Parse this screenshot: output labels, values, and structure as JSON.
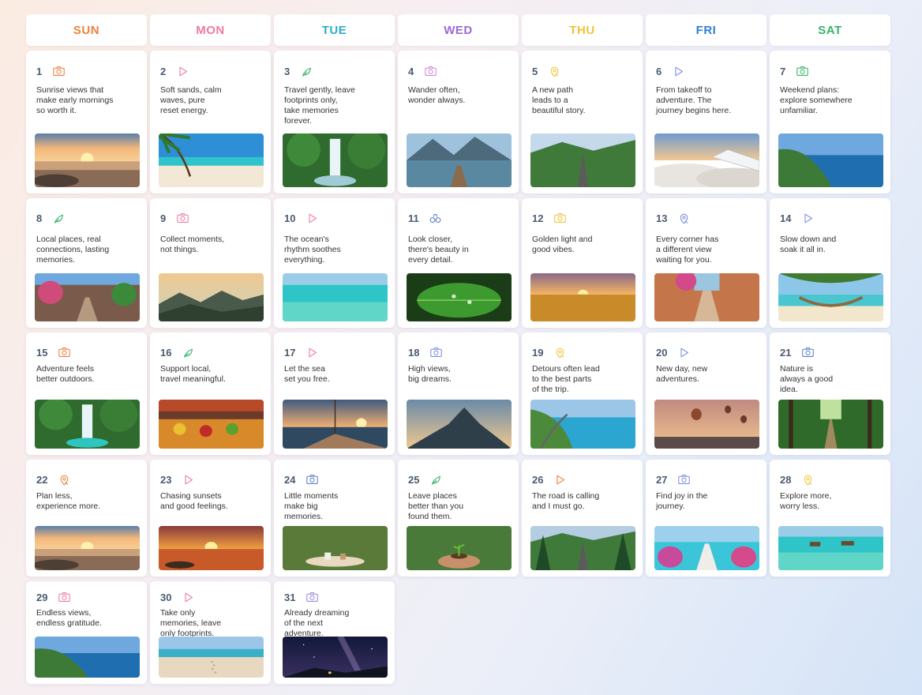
{
  "days": [
    {
      "label": "SUN",
      "color": "#f0803c"
    },
    {
      "label": "MON",
      "color": "#ef7aa0"
    },
    {
      "label": "TUE",
      "color": "#29aecb"
    },
    {
      "label": "WED",
      "color": "#9b6ad6"
    },
    {
      "label": "THU",
      "color": "#f1c43a"
    },
    {
      "label": "FRI",
      "color": "#2f7fd6"
    },
    {
      "label": "SAT",
      "color": "#36b36a"
    }
  ],
  "entries": [
    {
      "day": "1",
      "text": "Sunrise views that\nmake early mornings\nso worth it.",
      "icon": "camera-icon",
      "icon_color": "#f0803c",
      "scene": "sunset-beach"
    },
    {
      "day": "2",
      "text": "Soft sands, calm\nwaves, pure\nreset energy.",
      "icon": "play-icon",
      "icon_color": "#ef7aa0",
      "scene": "palm-beach"
    },
    {
      "day": "3",
      "text": "Travel gently, leave\nfootprints only,\ntake memories\nforever.",
      "icon": "leaf-icon",
      "icon_color": "#36b36a",
      "scene": "waterfall"
    },
    {
      "day": "4",
      "text": "Wander often,\nwonder always.",
      "icon": "camera-icon",
      "icon_color": "#d18ad6",
      "scene": "mountain-lake"
    },
    {
      "day": "5",
      "text": "A new path\nleads to a\nbeautiful story.",
      "icon": "map-icon",
      "icon_color": "#f1c43a",
      "scene": "green-road"
    },
    {
      "day": "6",
      "text": "From takeoff to\nadventure. The\njourney begins here.",
      "icon": "play-icon",
      "icon_color": "#7d8ee0",
      "scene": "plane-wing"
    },
    {
      "day": "7",
      "text": "Weekend plans:\nexplore somewhere\nunfamiliar.",
      "icon": "camera-icon",
      "icon_color": "#36b36a",
      "scene": "coast-cliff"
    },
    {
      "day": "8",
      "text": "Local places, real\nconnections, lasting\nmemories.",
      "icon": "leaf-icon",
      "icon_color": "#36b36a",
      "scene": "flower-street"
    },
    {
      "day": "9",
      "text": "Collect moments,\nnot things.",
      "icon": "camera-icon",
      "icon_color": "#ef7aa0",
      "scene": "misty-mountains"
    },
    {
      "day": "10",
      "text": "The ocean's\nrhythm soothes\neverything.",
      "icon": "play-icon",
      "icon_color": "#ef7aa0",
      "scene": "turquoise-sea"
    },
    {
      "day": "11",
      "text": "Look closer,\nthere's beauty in\nevery detail.",
      "icon": "binoculars-icon",
      "icon_color": "#5a80c8",
      "scene": "leaf-drops"
    },
    {
      "day": "12",
      "text": "Golden light and\ngood vibes.",
      "icon": "camera-icon",
      "icon_color": "#f1c43a",
      "scene": "golden-field"
    },
    {
      "day": "13",
      "text": "Every corner has\na different view\nwaiting for you.",
      "icon": "map-icon",
      "icon_color": "#7d8ee0",
      "scene": "alley"
    },
    {
      "day": "14",
      "text": "Slow down and\nsoak it all in.",
      "icon": "play-icon",
      "icon_color": "#7d8ee0",
      "scene": "hammock"
    },
    {
      "day": "15",
      "text": "Adventure feels\nbetter outdoors.",
      "icon": "camera-icon",
      "icon_color": "#f0803c",
      "scene": "jungle-waterfall"
    },
    {
      "day": "16",
      "text": "Support local,\ntravel meaningful.",
      "icon": "leaf-icon",
      "icon_color": "#36b36a",
      "scene": "market"
    },
    {
      "day": "17",
      "text": "Let the sea\nset you free.",
      "icon": "play-icon",
      "icon_color": "#ef7aa0",
      "scene": "boat-sunset"
    },
    {
      "day": "18",
      "text": "High views,\nbig dreams.",
      "icon": "camera-icon",
      "icon_color": "#7d8ee0",
      "scene": "peak"
    },
    {
      "day": "19",
      "text": "Detours often lead\nto the best parts\nof the trip.",
      "icon": "map-icon",
      "icon_color": "#f1c43a",
      "scene": "coast-road"
    },
    {
      "day": "20",
      "text": "New day, new\nadventures.",
      "icon": "play-icon",
      "icon_color": "#7d8ee0",
      "scene": "balloons"
    },
    {
      "day": "21",
      "text": "Nature is\nalways a good\nidea.",
      "icon": "camera-icon",
      "icon_color": "#5a80c8",
      "scene": "forest-path"
    },
    {
      "day": "22",
      "text": "Plan less,\nexperience more.",
      "icon": "map-icon",
      "icon_color": "#f0803c",
      "scene": "footprints-sunset"
    },
    {
      "day": "23",
      "text": "Chasing sunsets\nand good feelings.",
      "icon": "play-icon",
      "icon_color": "#ef7aa0",
      "scene": "orange-sunset"
    },
    {
      "day": "24",
      "text": "Little moments\nmake big\nmemories.",
      "icon": "camera-icon",
      "icon_color": "#5a80c8",
      "scene": "cafe"
    },
    {
      "day": "25",
      "text": "Leave places\nbetter than you\nfound them.",
      "icon": "leaf-icon",
      "icon_color": "#36b36a",
      "scene": "sprout-hands"
    },
    {
      "day": "26",
      "text": "The road is calling\nand I must go.",
      "icon": "play-icon",
      "icon_color": "#f0803c",
      "scene": "pine-road"
    },
    {
      "day": "27",
      "text": "Find joy in the\njourney.",
      "icon": "camera-icon",
      "icon_color": "#7d8ee0",
      "scene": "flower-dock"
    },
    {
      "day": "28",
      "text": "Explore more,\nworry less.",
      "icon": "map-icon",
      "icon_color": "#f1c43a",
      "scene": "water-huts"
    },
    {
      "day": "29",
      "text": "Endless views,\nendless gratitude.",
      "icon": "camera-icon",
      "icon_color": "#ef7aa0",
      "scene": "coast-cliff"
    },
    {
      "day": "30",
      "text": "Take only\nmemories, leave\nonly footprints.",
      "icon": "play-icon",
      "icon_color": "#ef7aa0",
      "scene": "sand-footprints"
    },
    {
      "day": "31",
      "text": "Already dreaming\nof the next\nadventure.",
      "icon": "camera-icon",
      "icon_color": "#9b8ae0",
      "scene": "night-sky"
    }
  ]
}
